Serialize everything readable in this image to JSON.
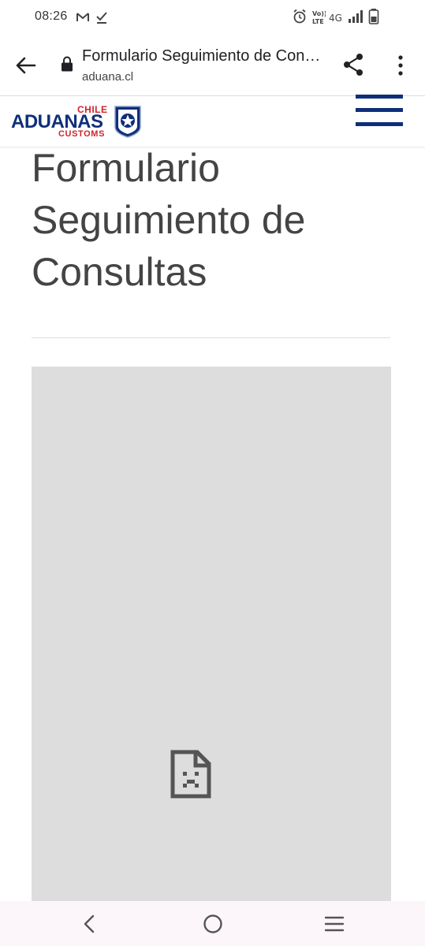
{
  "status_bar": {
    "time": "08:26",
    "left_icons": [
      "gmail-icon",
      "checkmark-download-icon"
    ],
    "right_icons": [
      "alarm-icon",
      "volte-icon",
      "network-4g-icon",
      "signal-icon",
      "battery-icon"
    ],
    "network_label": "4G",
    "volte_label_top": "Vo))",
    "volte_label_bottom": "LTE"
  },
  "browser": {
    "page_title": "Formulario Seguimiento de Consultas",
    "domain": "aduana.cl"
  },
  "site_header": {
    "logo": {
      "chile": "CHILE",
      "aduanas": "ADUANAS",
      "customs": "CUSTOMS"
    },
    "colors": {
      "brand_blue": "#0f2f7a",
      "brand_red": "#d0242b"
    }
  },
  "content": {
    "title": "Formulario Seguimiento de Consultas",
    "embed_state": "failed-to-load"
  },
  "nav_bar": {
    "buttons": [
      "back",
      "home",
      "recents"
    ]
  }
}
